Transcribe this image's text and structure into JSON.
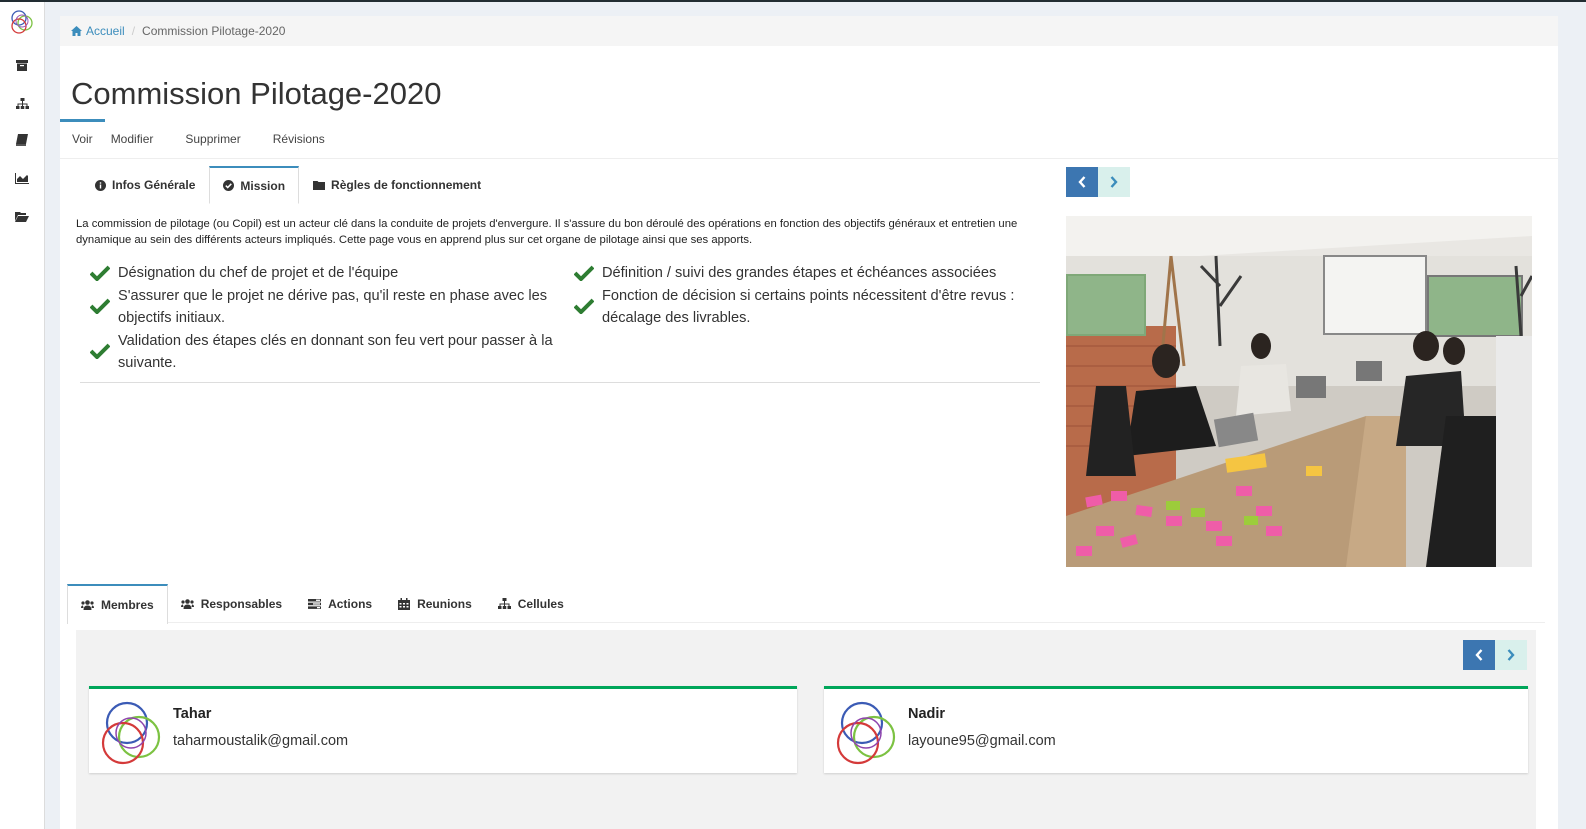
{
  "breadcrumb": {
    "home": "Accueil",
    "current": "Commission Pilotage-2020"
  },
  "page": {
    "title": "Commission Pilotage-2020"
  },
  "primary_tabs": [
    "Voir",
    "Modifier",
    "Supprimer",
    "Révisions"
  ],
  "info_tabs": [
    {
      "label": "Infos Générale",
      "icon": "info-circle-icon"
    },
    {
      "label": "Mission",
      "icon": "check-circle-icon",
      "active": true
    },
    {
      "label": "Règles de fonctionnement",
      "icon": "folder-icon"
    }
  ],
  "mission": {
    "text": "La commission de pilotage (ou Copil) est un acteur clé dans la conduite de projets d'envergure. Il s'assure du bon déroulé des opérations en fonction des objectifs généraux et entretien une dynamique au sein des différents acteurs impliqués. Cette page vous en apprend plus sur cet organe de pilotage ainsi que ses apports.",
    "left_items": [
      "Désignation du chef de projet et de l'équipe",
      "S'assurer que le projet ne dérive pas, qu'il reste en phase avec les objectifs initiaux.",
      "Validation des étapes clés en donnant son feu vert pour passer à la suivante."
    ],
    "right_items": [
      "Définition / suivi des grandes étapes et échéances associées",
      "Fonction de décision si certains points nécessitent d'être revus : décalage des livrables."
    ]
  },
  "bottom_tabs": [
    {
      "label": "Membres",
      "icon": "users-icon",
      "active": true
    },
    {
      "label": "Responsables",
      "icon": "users-icon"
    },
    {
      "label": "Actions",
      "icon": "tasks-icon"
    },
    {
      "label": "Reunions",
      "icon": "calendar-icon"
    },
    {
      "label": "Cellules",
      "icon": "sitemap-icon"
    }
  ],
  "members": [
    {
      "name": "Tahar",
      "email": "taharmoustalik@gmail.com"
    },
    {
      "name": "Nadir",
      "email": "layoune95@gmail.com"
    }
  ],
  "sidebar_icons": [
    "archive-icon",
    "sitemap-icon",
    "book-icon",
    "area-chart-icon",
    "folder-open-icon"
  ],
  "colors": {
    "accent": "#3c8dbc",
    "check": "#2e7d32",
    "card_border": "#00a65a",
    "nav_prev": "#3c76b1",
    "nav_next": "#d9f0ec"
  }
}
